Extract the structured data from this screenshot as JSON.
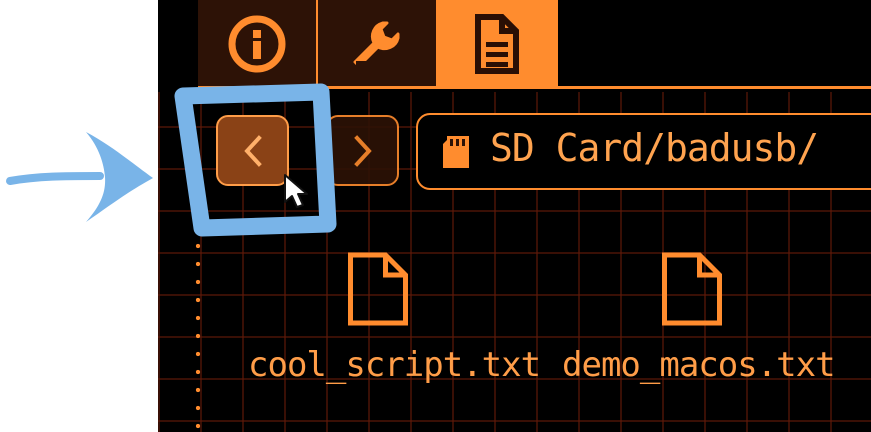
{
  "tabs": [
    {
      "label": "",
      "icon": "info-icon"
    },
    {
      "label": "",
      "icon": "wrench-icon"
    },
    {
      "label": "",
      "icon": "document-icon"
    }
  ],
  "nav": {
    "back_icon": "chevron-left-icon",
    "forward_icon": "chevron-right-icon"
  },
  "path": {
    "value": "SD Card/badusb/",
    "icon": "sd-card-icon"
  },
  "files": [
    {
      "name": "cool_script.txt",
      "icon": "file-icon"
    },
    {
      "name": "demo_macos.txt",
      "icon": "file-icon"
    }
  ],
  "colors": {
    "accent": "#ff8c2e",
    "background": "#000000",
    "highlight": "#79b4e8"
  }
}
